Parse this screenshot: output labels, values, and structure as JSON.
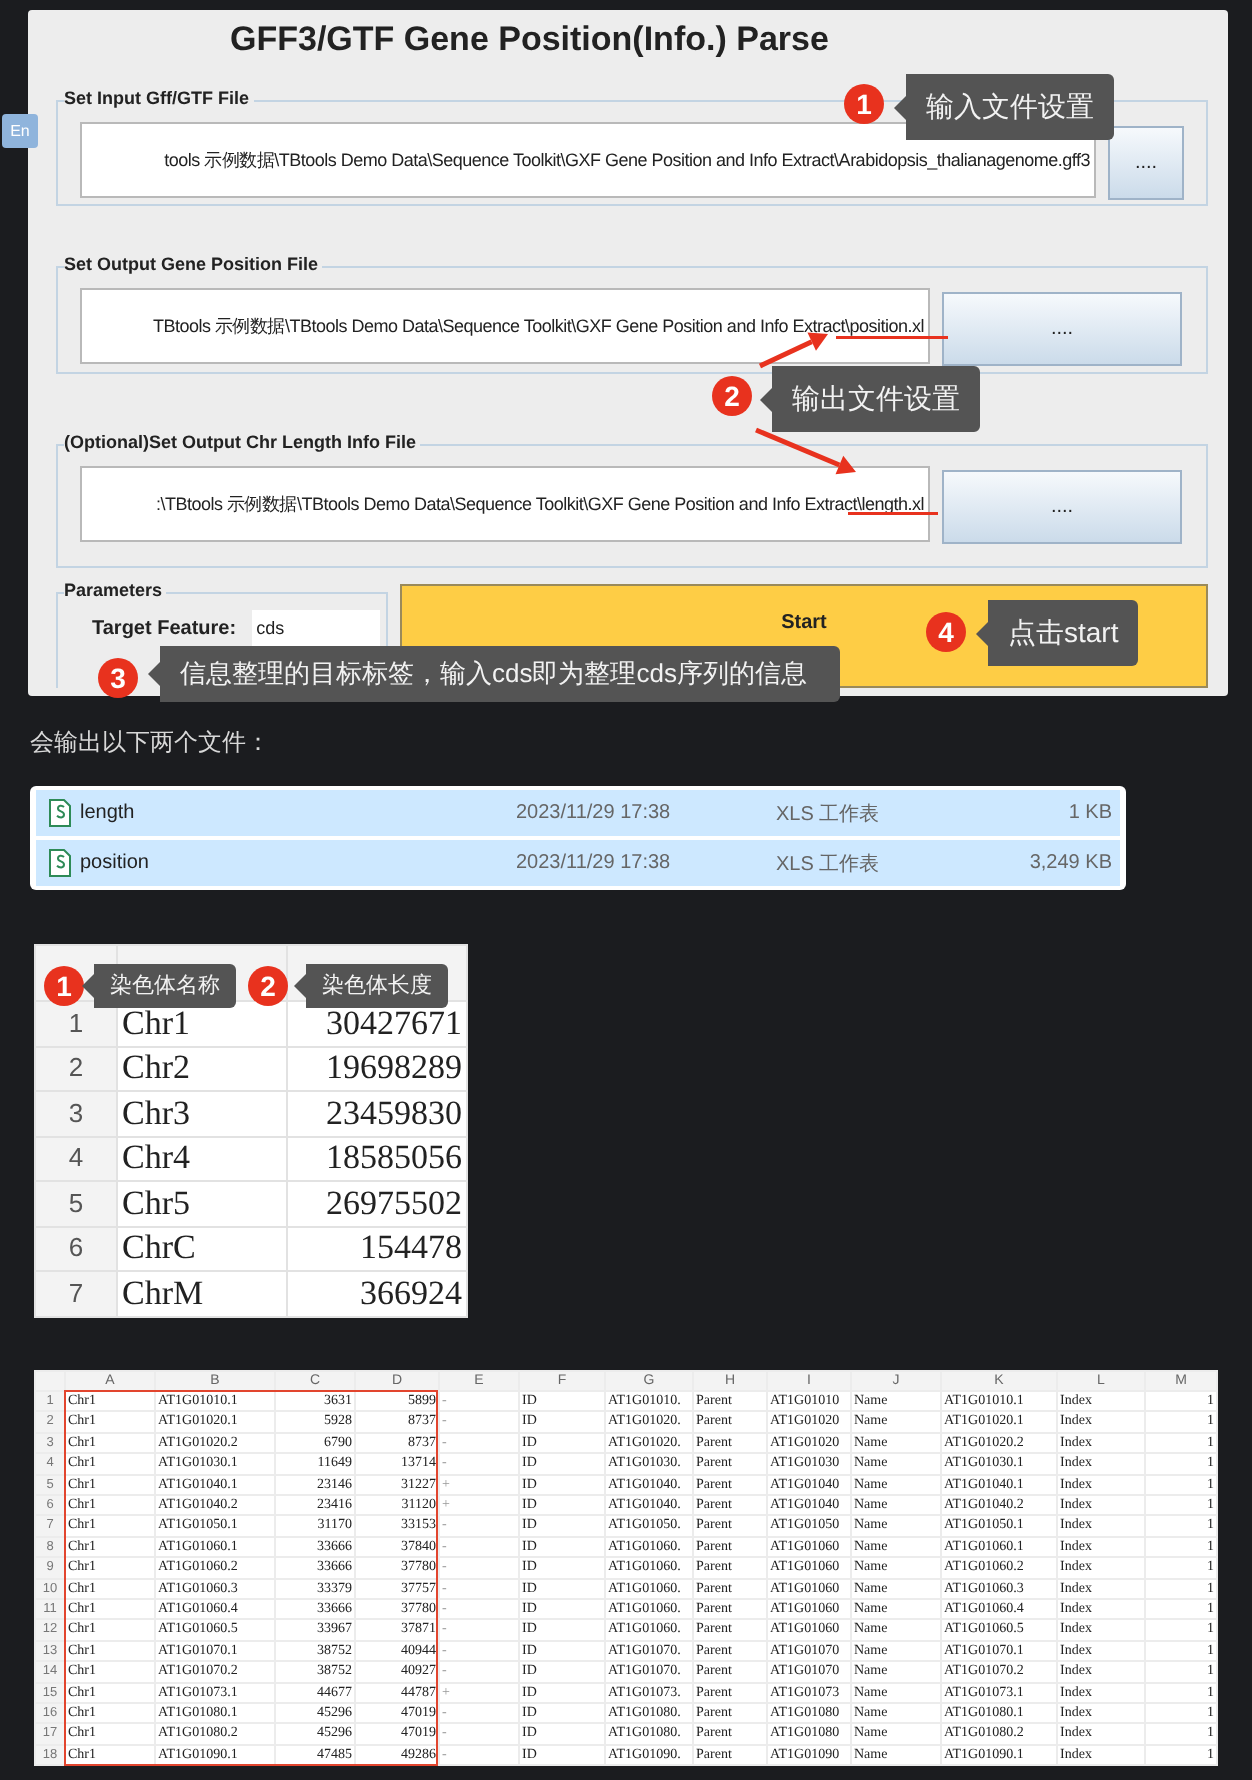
{
  "app_window": {
    "title": "GFF3/GTF Gene Position(Info.) Parse",
    "ime_badge": "En",
    "groups": [
      {
        "legend": "Set Input Gff/GTF File",
        "path": "tools 示例数据\\TBtools Demo Data\\Sequence Toolkit\\GXF Gene Position and Info Extract\\Arabidopsis_thalianagenome.gff3",
        "button": "...."
      },
      {
        "legend": "Set Output Gene Position File",
        "path": "TBtools 示例数据\\TBtools Demo Data\\Sequence Toolkit\\GXF Gene Position and Info Extract\\position.xl",
        "button": "...."
      },
      {
        "legend": "(Optional)Set Output Chr Length Info File",
        "path": ":\\TBtools 示例数据\\TBtools Demo Data\\Sequence Toolkit\\GXF Gene Position and Info Extract\\length.xl",
        "button": "...."
      }
    ],
    "parameters": {
      "legend": "Parameters",
      "label": "Target Feature:",
      "value": "cds"
    },
    "start_button": "Start",
    "callouts": [
      {
        "number": "1",
        "text": "输入文件设置"
      },
      {
        "number": "2",
        "text": "输出文件设置"
      },
      {
        "number": "3",
        "text": "信息整理的目标标签，输入cds即为整理cds序列的信息"
      },
      {
        "number": "4",
        "text": "点击start"
      }
    ]
  },
  "note": "会输出以下两个文件：",
  "file_list": [
    {
      "name": "length",
      "modified": "2023/11/29 17:38",
      "type": "XLS 工作表",
      "size": "1 KB",
      "selected": true
    },
    {
      "name": "position",
      "modified": "2023/11/29 17:38",
      "type": "XLS 工作表",
      "size": "3,249 KB",
      "selected": true
    }
  ],
  "chr_sheet": {
    "rows": [
      {
        "row": "1",
        "name": "Chr1",
        "length": "30427671"
      },
      {
        "row": "2",
        "name": "Chr2",
        "length": "19698289"
      },
      {
        "row": "3",
        "name": "Chr3",
        "length": "23459830"
      },
      {
        "row": "4",
        "name": "Chr4",
        "length": "18585056"
      },
      {
        "row": "5",
        "name": "Chr5",
        "length": "26975502"
      },
      {
        "row": "6",
        "name": "ChrC",
        "length": "154478"
      },
      {
        "row": "7",
        "name": "ChrM",
        "length": "366924"
      }
    ],
    "callouts": [
      {
        "number": "1",
        "text": "染色体名称"
      },
      {
        "number": "2",
        "text": "染色体长度"
      }
    ]
  },
  "position_sheet": {
    "columns": [
      "A",
      "B",
      "C",
      "D",
      "E",
      "F",
      "G",
      "H",
      "I",
      "J",
      "K",
      "L",
      "M"
    ],
    "rows": [
      {
        "row": "1",
        "cells": [
          "Chr1",
          "AT1G01010.1",
          "3631",
          "5899",
          "-",
          "ID",
          "AT1G01010.",
          "Parent",
          "AT1G01010",
          "Name",
          "AT1G01010.1",
          "Index",
          "1"
        ]
      },
      {
        "row": "2",
        "cells": [
          "Chr1",
          "AT1G01020.1",
          "5928",
          "8737",
          "-",
          "ID",
          "AT1G01020.",
          "Parent",
          "AT1G01020",
          "Name",
          "AT1G01020.1",
          "Index",
          "1"
        ]
      },
      {
        "row": "3",
        "cells": [
          "Chr1",
          "AT1G01020.2",
          "6790",
          "8737",
          "-",
          "ID",
          "AT1G01020.",
          "Parent",
          "AT1G01020",
          "Name",
          "AT1G01020.2",
          "Index",
          "1"
        ]
      },
      {
        "row": "4",
        "cells": [
          "Chr1",
          "AT1G01030.1",
          "11649",
          "13714",
          "-",
          "ID",
          "AT1G01030.",
          "Parent",
          "AT1G01030",
          "Name",
          "AT1G01030.1",
          "Index",
          "1"
        ]
      },
      {
        "row": "5",
        "cells": [
          "Chr1",
          "AT1G01040.1",
          "23146",
          "31227",
          "+",
          "ID",
          "AT1G01040.",
          "Parent",
          "AT1G01040",
          "Name",
          "AT1G01040.1",
          "Index",
          "1"
        ]
      },
      {
        "row": "6",
        "cells": [
          "Chr1",
          "AT1G01040.2",
          "23416",
          "31120",
          "+",
          "ID",
          "AT1G01040.",
          "Parent",
          "AT1G01040",
          "Name",
          "AT1G01040.2",
          "Index",
          "1"
        ]
      },
      {
        "row": "7",
        "cells": [
          "Chr1",
          "AT1G01050.1",
          "31170",
          "33153",
          "-",
          "ID",
          "AT1G01050.",
          "Parent",
          "AT1G01050",
          "Name",
          "AT1G01050.1",
          "Index",
          "1"
        ]
      },
      {
        "row": "8",
        "cells": [
          "Chr1",
          "AT1G01060.1",
          "33666",
          "37840",
          "-",
          "ID",
          "AT1G01060.",
          "Parent",
          "AT1G01060",
          "Name",
          "AT1G01060.1",
          "Index",
          "1"
        ]
      },
      {
        "row": "9",
        "cells": [
          "Chr1",
          "AT1G01060.2",
          "33666",
          "37780",
          "-",
          "ID",
          "AT1G01060.",
          "Parent",
          "AT1G01060",
          "Name",
          "AT1G01060.2",
          "Index",
          "1"
        ]
      },
      {
        "row": "10",
        "cells": [
          "Chr1",
          "AT1G01060.3",
          "33379",
          "37757",
          "-",
          "ID",
          "AT1G01060.",
          "Parent",
          "AT1G01060",
          "Name",
          "AT1G01060.3",
          "Index",
          "1"
        ]
      },
      {
        "row": "11",
        "cells": [
          "Chr1",
          "AT1G01060.4",
          "33666",
          "37780",
          "-",
          "ID",
          "AT1G01060.",
          "Parent",
          "AT1G01060",
          "Name",
          "AT1G01060.4",
          "Index",
          "1"
        ]
      },
      {
        "row": "12",
        "cells": [
          "Chr1",
          "AT1G01060.5",
          "33967",
          "37871",
          "-",
          "ID",
          "AT1G01060.",
          "Parent",
          "AT1G01060",
          "Name",
          "AT1G01060.5",
          "Index",
          "1"
        ]
      },
      {
        "row": "13",
        "cells": [
          "Chr1",
          "AT1G01070.1",
          "38752",
          "40944",
          "-",
          "ID",
          "AT1G01070.",
          "Parent",
          "AT1G01070",
          "Name",
          "AT1G01070.1",
          "Index",
          "1"
        ]
      },
      {
        "row": "14",
        "cells": [
          "Chr1",
          "AT1G01070.2",
          "38752",
          "40927",
          "-",
          "ID",
          "AT1G01070.",
          "Parent",
          "AT1G01070",
          "Name",
          "AT1G01070.2",
          "Index",
          "1"
        ]
      },
      {
        "row": "15",
        "cells": [
          "Chr1",
          "AT1G01073.1",
          "44677",
          "44787",
          "+",
          "ID",
          "AT1G01073.",
          "Parent",
          "AT1G01073",
          "Name",
          "AT1G01073.1",
          "Index",
          "1"
        ]
      },
      {
        "row": "16",
        "cells": [
          "Chr1",
          "AT1G01080.1",
          "45296",
          "47019",
          "-",
          "ID",
          "AT1G01080.",
          "Parent",
          "AT1G01080",
          "Name",
          "AT1G01080.1",
          "Index",
          "1"
        ]
      },
      {
        "row": "17",
        "cells": [
          "Chr1",
          "AT1G01080.2",
          "45296",
          "47019",
          "-",
          "ID",
          "AT1G01080.",
          "Parent",
          "AT1G01080",
          "Name",
          "AT1G01080.2",
          "Index",
          "1"
        ]
      },
      {
        "row": "18",
        "cells": [
          "Chr1",
          "AT1G01090.1",
          "47485",
          "49286",
          "-",
          "ID",
          "AT1G01090.",
          "Parent",
          "AT1G01090",
          "Name",
          "AT1G01090.1",
          "Index",
          "1"
        ]
      }
    ]
  }
}
